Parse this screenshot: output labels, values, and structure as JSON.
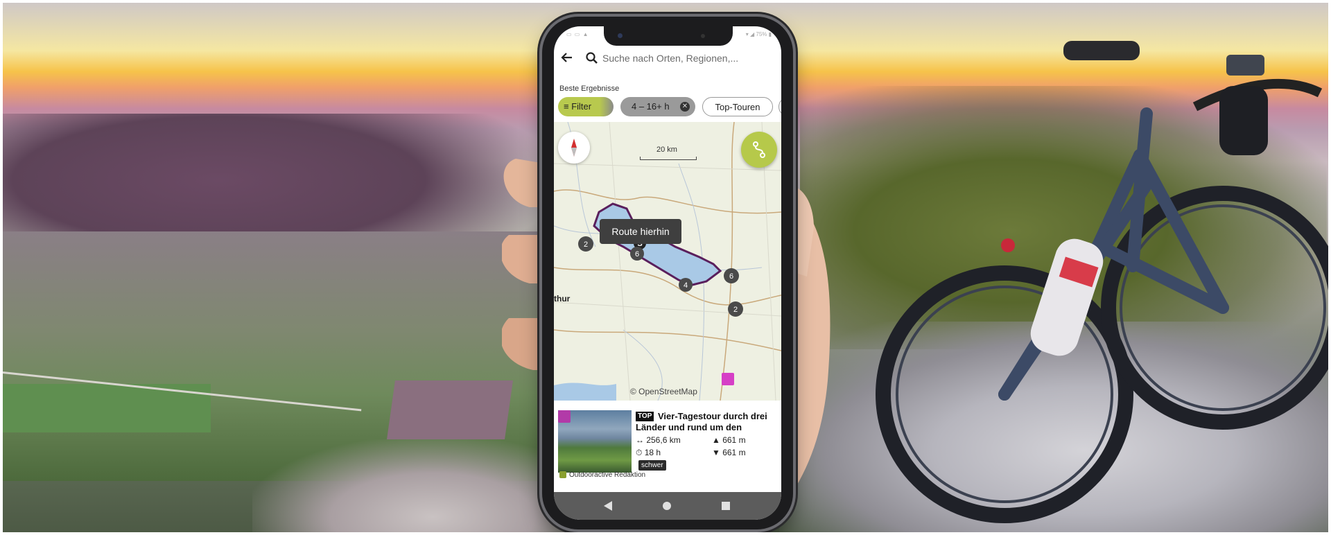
{
  "status_bar": {
    "left": "▭ ▭ ▲",
    "right": "▾ ◢ 75% ▮"
  },
  "search": {
    "placeholder": "Suche nach Orten, Regionen,..."
  },
  "results": {
    "section_label": "Beste Ergebnisse"
  },
  "chips": {
    "filter_label": "Filter",
    "duration_label": "4 – 16+ h",
    "top_tours_label": "Top-Touren"
  },
  "map": {
    "scale_label": "20 km",
    "tooltip": "Route hierhin",
    "attribution": "© OpenStreetMap",
    "place_label": "thur",
    "start_marker": "S",
    "clusters": [
      "2",
      "6",
      "4",
      "6",
      "2"
    ],
    "lake_color": "#a9c9e6",
    "route_color": "#5a1f5c",
    "accent_color": "#b6c94a"
  },
  "tour": {
    "badge": "TOP",
    "title": "Vier-Tagestour durch drei Länder und rund um den",
    "distance": "↔ 256,6 km",
    "duration": "⏱ 18 h",
    "ascent": "▲ 661 m",
    "descent": "▼ 661 m",
    "difficulty": "schwer",
    "author": "Outdooractive Redaktion"
  },
  "icons": {
    "back": "arrow-left-icon",
    "search": "search-icon",
    "compass": "compass-icon",
    "route": "route-icon",
    "close": "close-icon"
  }
}
